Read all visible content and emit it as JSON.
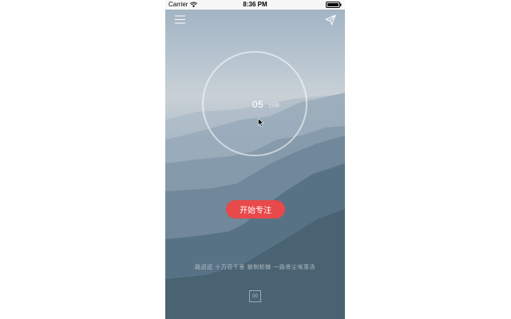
{
  "status_bar": {
    "carrier": "Carrier",
    "time": "8:36 PM"
  },
  "header": {
    "menu_icon": "hamburger-menu-icon",
    "share_icon": "paper-plane-icon"
  },
  "timer": {
    "value": "05",
    "unit": "分钟"
  },
  "start_button": {
    "label": "开始专注",
    "color": "#e8494b"
  },
  "quote": {
    "text": "路迢迢   十万百千里   披荆斩棘   一路将尘埃落汤"
  },
  "counter": {
    "value": "00"
  }
}
